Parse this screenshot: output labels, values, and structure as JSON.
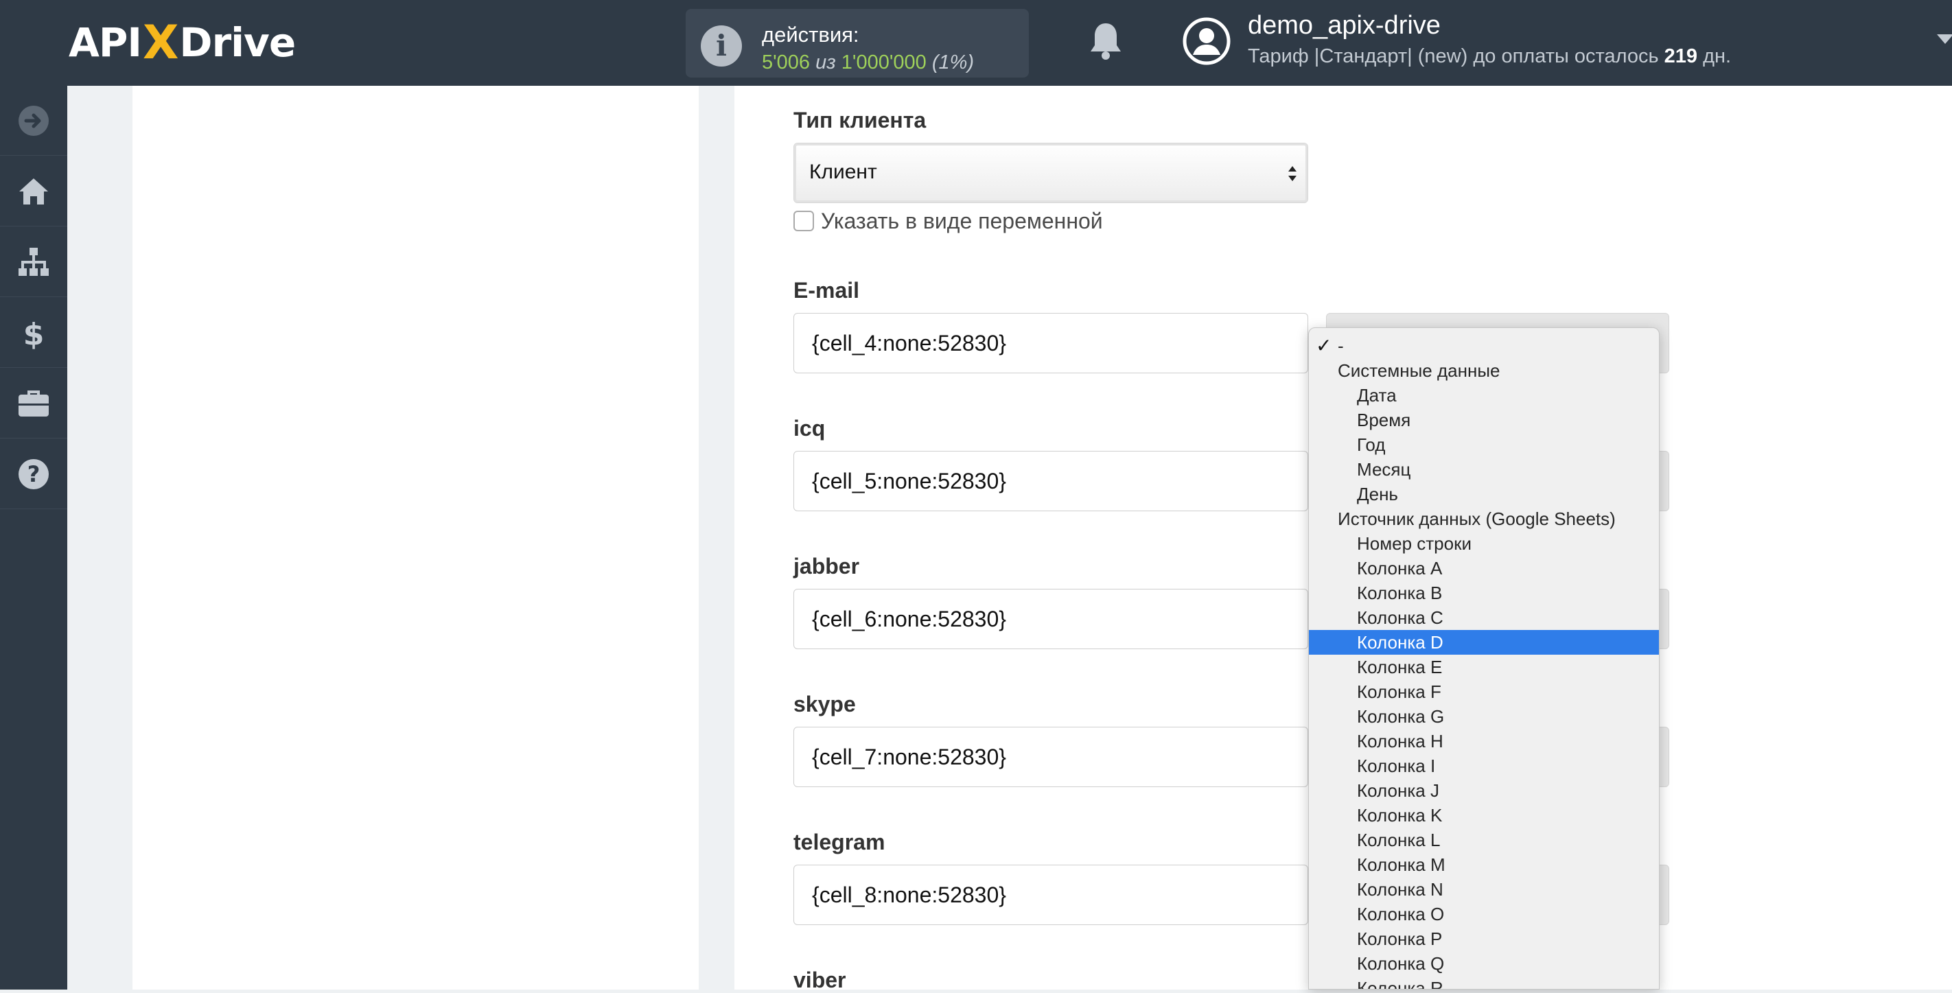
{
  "header": {
    "logo": {
      "left": "API",
      "x": "X",
      "right": "Drive"
    },
    "actions": {
      "label": "действия:",
      "used": "5'006",
      "of": "из",
      "total": "1'000'000",
      "percent": "(1%)"
    },
    "user": {
      "name": "demo_apix-drive",
      "tariff_prefix": "Тариф |Стандарт| (new) до оплаты осталось",
      "days": "219",
      "days_suffix": "дн."
    }
  },
  "sidebar": {
    "items": [
      {
        "icon": "arrow-right-circle-icon"
      },
      {
        "icon": "home-icon"
      },
      {
        "icon": "sitemap-icon"
      },
      {
        "icon": "dollar-icon"
      },
      {
        "icon": "briefcase-icon"
      },
      {
        "icon": "help-icon"
      }
    ]
  },
  "form": {
    "client_type": {
      "label": "Тип клиента",
      "value": "Клиент",
      "checkbox_label": "Указать в виде переменной"
    },
    "fields": [
      {
        "label": "E-mail",
        "value": "{cell_4:none:52830}"
      },
      {
        "label": "icq",
        "value": "{cell_5:none:52830}"
      },
      {
        "label": "jabber",
        "value": "{cell_6:none:52830}"
      },
      {
        "label": "skype",
        "value": "{cell_7:none:52830}"
      },
      {
        "label": "telegram",
        "value": "{cell_8:none:52830}"
      },
      {
        "label": "viber"
      }
    ]
  },
  "dropdown": {
    "checked_item": "-",
    "group_system": "Системные данные",
    "system_items": [
      "Дата",
      "Время",
      "Год",
      "Месяц",
      "День"
    ],
    "group_source": "Источник данных (Google Sheets)",
    "source_items": [
      "Номер строки",
      "Колонка A",
      "Колонка B",
      "Колонка C",
      "Колонка D",
      "Колонка E",
      "Колонка F",
      "Колонка G",
      "Колонка H",
      "Колонка I",
      "Колонка J",
      "Колонка K",
      "Колонка L",
      "Колонка M",
      "Колонка N",
      "Колонка O",
      "Колонка P",
      "Колонка Q",
      "Колонка R"
    ],
    "selected": "Колонка D"
  },
  "colors": {
    "header_bg": "#2f3a46",
    "accent_yellow": "#f7b71c",
    "selection_blue": "#2f7de9",
    "counter_green": "#9fd15a"
  }
}
